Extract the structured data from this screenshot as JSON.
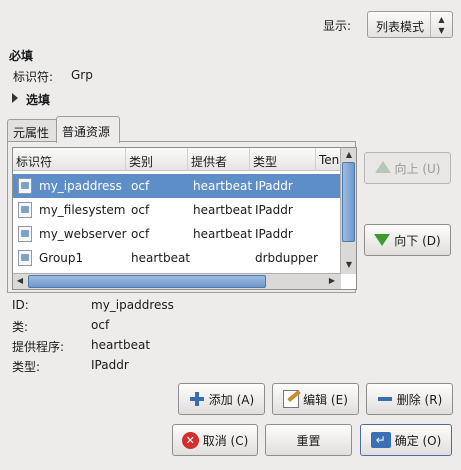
{
  "display": {
    "label": "显示:",
    "value": "列表模式"
  },
  "required": {
    "heading": "必填",
    "id_label": "标识符:",
    "id_value": "Grp"
  },
  "optional": {
    "heading": "选填"
  },
  "tabs": [
    {
      "label": "元属性"
    },
    {
      "label": "普通资源"
    }
  ],
  "table": {
    "columns": [
      "标识符",
      "类别",
      "提供者",
      "类型",
      "Ten"
    ],
    "rows": [
      {
        "id": "my_ipaddress",
        "class": "ocf",
        "provider": "heartbeat",
        "type": "IPaddr",
        "selected": true
      },
      {
        "id": "my_filesystem",
        "class": "ocf",
        "provider": "heartbeat",
        "type": "IPaddr",
        "selected": false
      },
      {
        "id": "my_webserver",
        "class": "ocf",
        "provider": "heartbeat",
        "type": "IPaddr",
        "selected": false
      },
      {
        "id": "Group1",
        "class": "heartbeat",
        "provider": "",
        "type": "drbdupper",
        "selected": false
      }
    ]
  },
  "move_buttons": {
    "up": "向上 (U)",
    "down": "向下 (D)"
  },
  "details": [
    {
      "label": "ID:",
      "value": "my_ipaddress"
    },
    {
      "label": "类:",
      "value": "ocf"
    },
    {
      "label": "提供程序:",
      "value": "heartbeat"
    },
    {
      "label": "类型:",
      "value": "IPaddr"
    }
  ],
  "actions": {
    "add": "添加 (A)",
    "edit": "编辑 (E)",
    "delete": "删除 (R)"
  },
  "dialog": {
    "cancel": "取消 (C)",
    "reset": "重置",
    "ok": "确定 (O)"
  },
  "colors": {
    "selection": "#5e8ec7",
    "window_bg": "#edeceb"
  }
}
